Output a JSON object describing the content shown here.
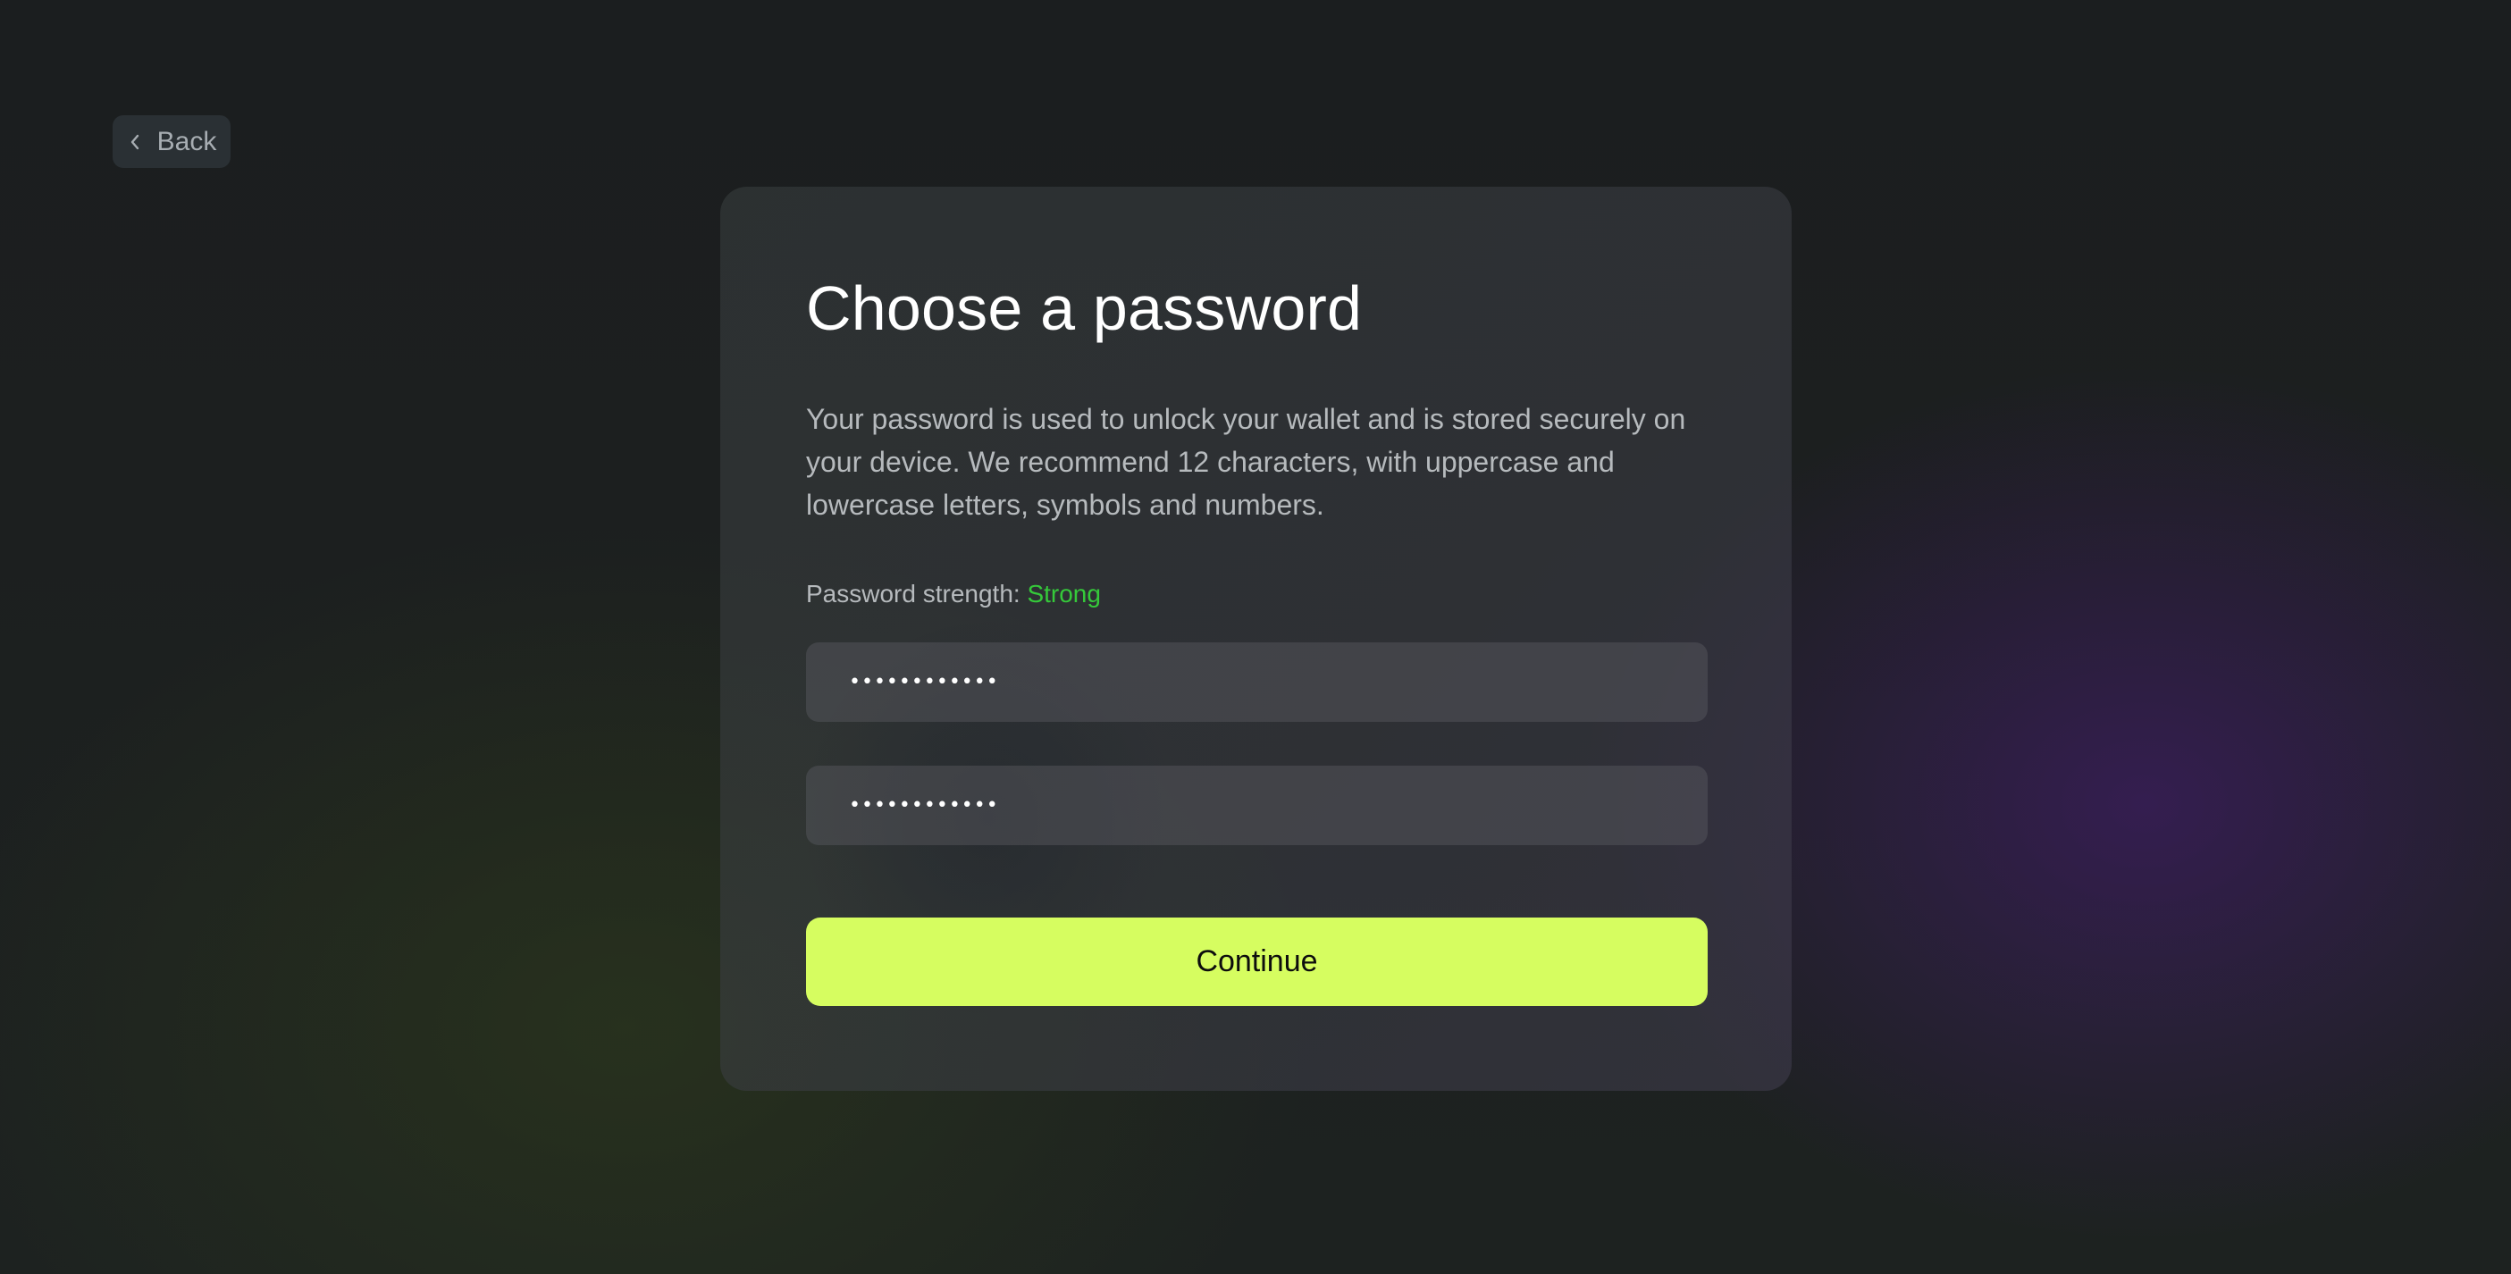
{
  "nav": {
    "back_label": "Back",
    "back_icon": "chevron-left-icon"
  },
  "card": {
    "title": "Choose a password",
    "description": "Your password is used to unlock your wallet and is stored securely on your device. We recommend 12 characters, with uppercase and lowercase letters, symbols and numbers.",
    "strength_label": "Password strength:",
    "strength_value": "Strong",
    "password_field": {
      "value": "••••••••••••"
    },
    "confirm_field": {
      "value": "••••••••••••"
    },
    "continue_label": "Continue"
  },
  "colors": {
    "accent": "#d6fd60",
    "strength_strong": "#35c93a",
    "background": "#1a1d1e",
    "card": "#3a4040"
  }
}
